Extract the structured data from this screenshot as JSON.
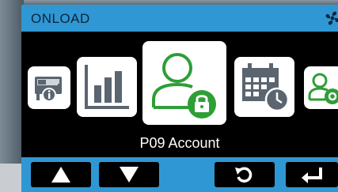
{
  "header": {
    "title": "ONLOAD",
    "icon": "fan-icon"
  },
  "menu": {
    "selected_label": "P09 Account",
    "items": [
      {
        "icon": "device-info-icon"
      },
      {
        "icon": "chart-icon"
      },
      {
        "icon": "account-lock-icon",
        "selected": true
      },
      {
        "icon": "calendar-clock-icon"
      },
      {
        "icon": "user-settings-icon"
      }
    ]
  },
  "buttons": [
    {
      "icon": "up-arrow-icon"
    },
    {
      "icon": "down-arrow-icon"
    },
    {
      "icon": "back-icon"
    },
    {
      "icon": "enter-icon"
    }
  ],
  "colors": {
    "accent": "#2f97d4",
    "icon_gray": "#5a6570",
    "icon_green": "#2e9e35",
    "screen": "#000000"
  }
}
